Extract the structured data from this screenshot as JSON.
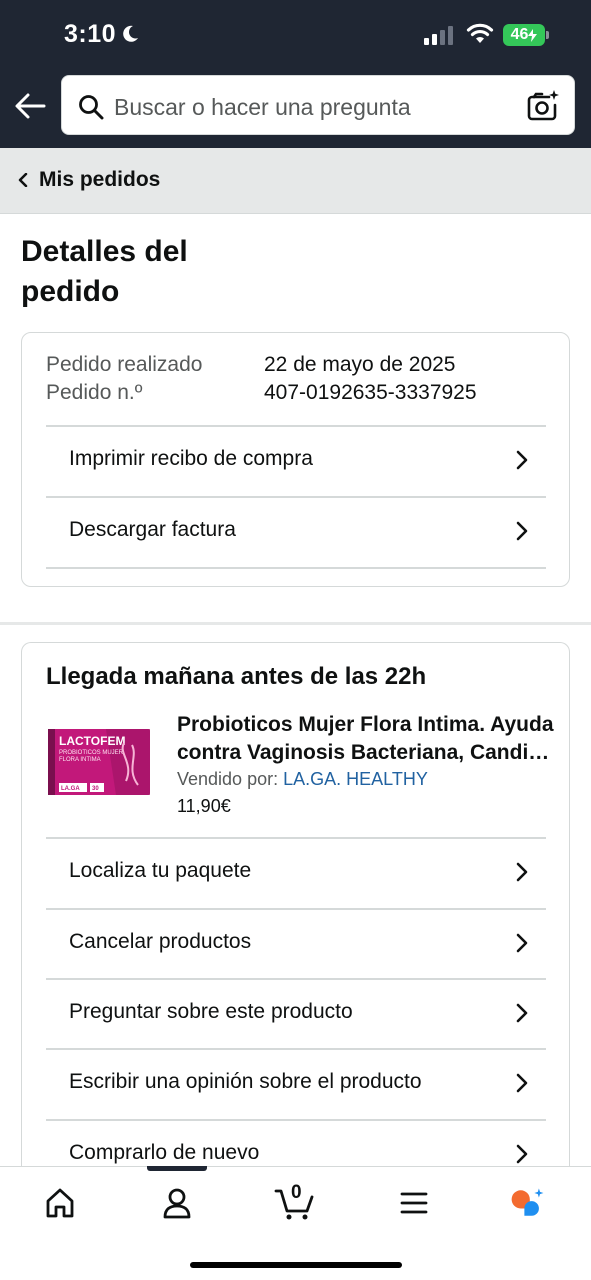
{
  "status_bar": {
    "time": "3:10",
    "battery": "46"
  },
  "search": {
    "placeholder": "Buscar o hacer una pregunta"
  },
  "breadcrumb": {
    "label": "Mis pedidos"
  },
  "page": {
    "title": "Detalles del pedido"
  },
  "order": {
    "placed_label": "Pedido realizado",
    "placed_value": "22 de mayo de 2025",
    "number_label": "Pedido n.º",
    "number_value": "407-0192635-3337925",
    "actions": [
      "Imprimir recibo de compra",
      "Descargar factura"
    ]
  },
  "shipment": {
    "arrival": "Llegada mañana antes de las 22h",
    "product": {
      "title_line1": "Probioticos Mujer Flora Intima. Ayuda",
      "title_line2": "contra Vaginosis Bacteriana, Candi…",
      "seller_prefix": "Vendido por:",
      "seller_name": "LA.GA. HEALTHY",
      "price": "11,90€",
      "image_brand": "LACTOFEM",
      "image_sub1": "PROBIOTICOS MUJER",
      "image_sub2": "FLORA INTIMA",
      "image_badge": "LA.GA",
      "image_count": "30"
    },
    "actions": [
      "Localiza tu paquete",
      "Cancelar productos",
      "Preguntar sobre este producto",
      "Escribir una opinión sobre el producto",
      "Comprarlo de nuevo"
    ]
  },
  "tabbar": {
    "cart_count": "0"
  },
  "colors": {
    "header": "#1f2633",
    "link": "#2162a1",
    "battery": "#34c759",
    "rufus_orange": "#f36b2f",
    "rufus_blue": "#1f8ff0"
  }
}
